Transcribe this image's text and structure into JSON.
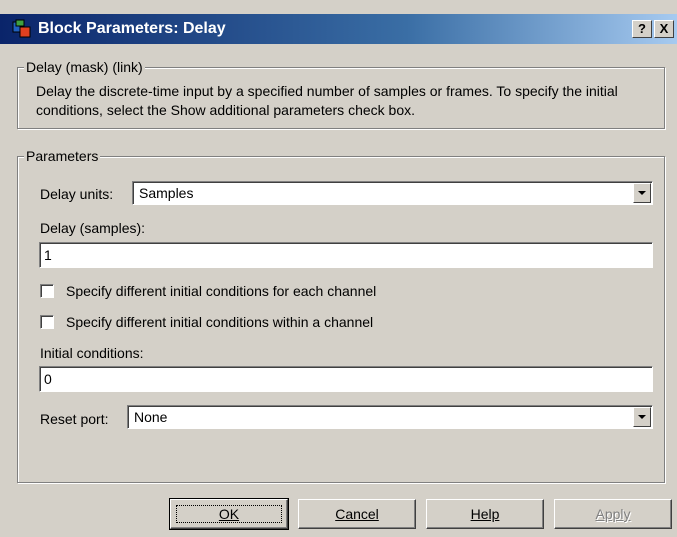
{
  "window": {
    "title": "Block Parameters: Delay",
    "help_glyph": "?",
    "close_glyph": "X"
  },
  "mask_group": {
    "label": "Delay (mask) (link)",
    "description": "Delay the discrete-time input by a specified number of samples or frames. To specify the initial conditions, select the Show additional parameters check box."
  },
  "params_group": {
    "label": "Parameters",
    "delay_units_label": "Delay units:",
    "delay_units_value": "Samples",
    "delay_label": "Delay (samples):",
    "delay_value": "1",
    "checkbox_each_channel": {
      "label": "Specify different initial conditions for each channel",
      "checked": false
    },
    "checkbox_within_channel": {
      "label": "Specify different initial conditions within a channel",
      "checked": false
    },
    "initial_conditions_label": "Initial conditions:",
    "initial_conditions_value": "0",
    "reset_port_label": "Reset port:",
    "reset_port_value": "None"
  },
  "buttons": {
    "ok": "OK",
    "cancel": "Cancel",
    "help": "Help",
    "apply": "Apply"
  },
  "colors": {
    "title_bar_start": "#0a246a",
    "title_bar_end": "#a6caf0",
    "window_bg": "#d4d0c8"
  },
  "icons": {
    "title_icon": "simulink-block-icon",
    "dropdown_arrow": "chevron-down-icon"
  }
}
